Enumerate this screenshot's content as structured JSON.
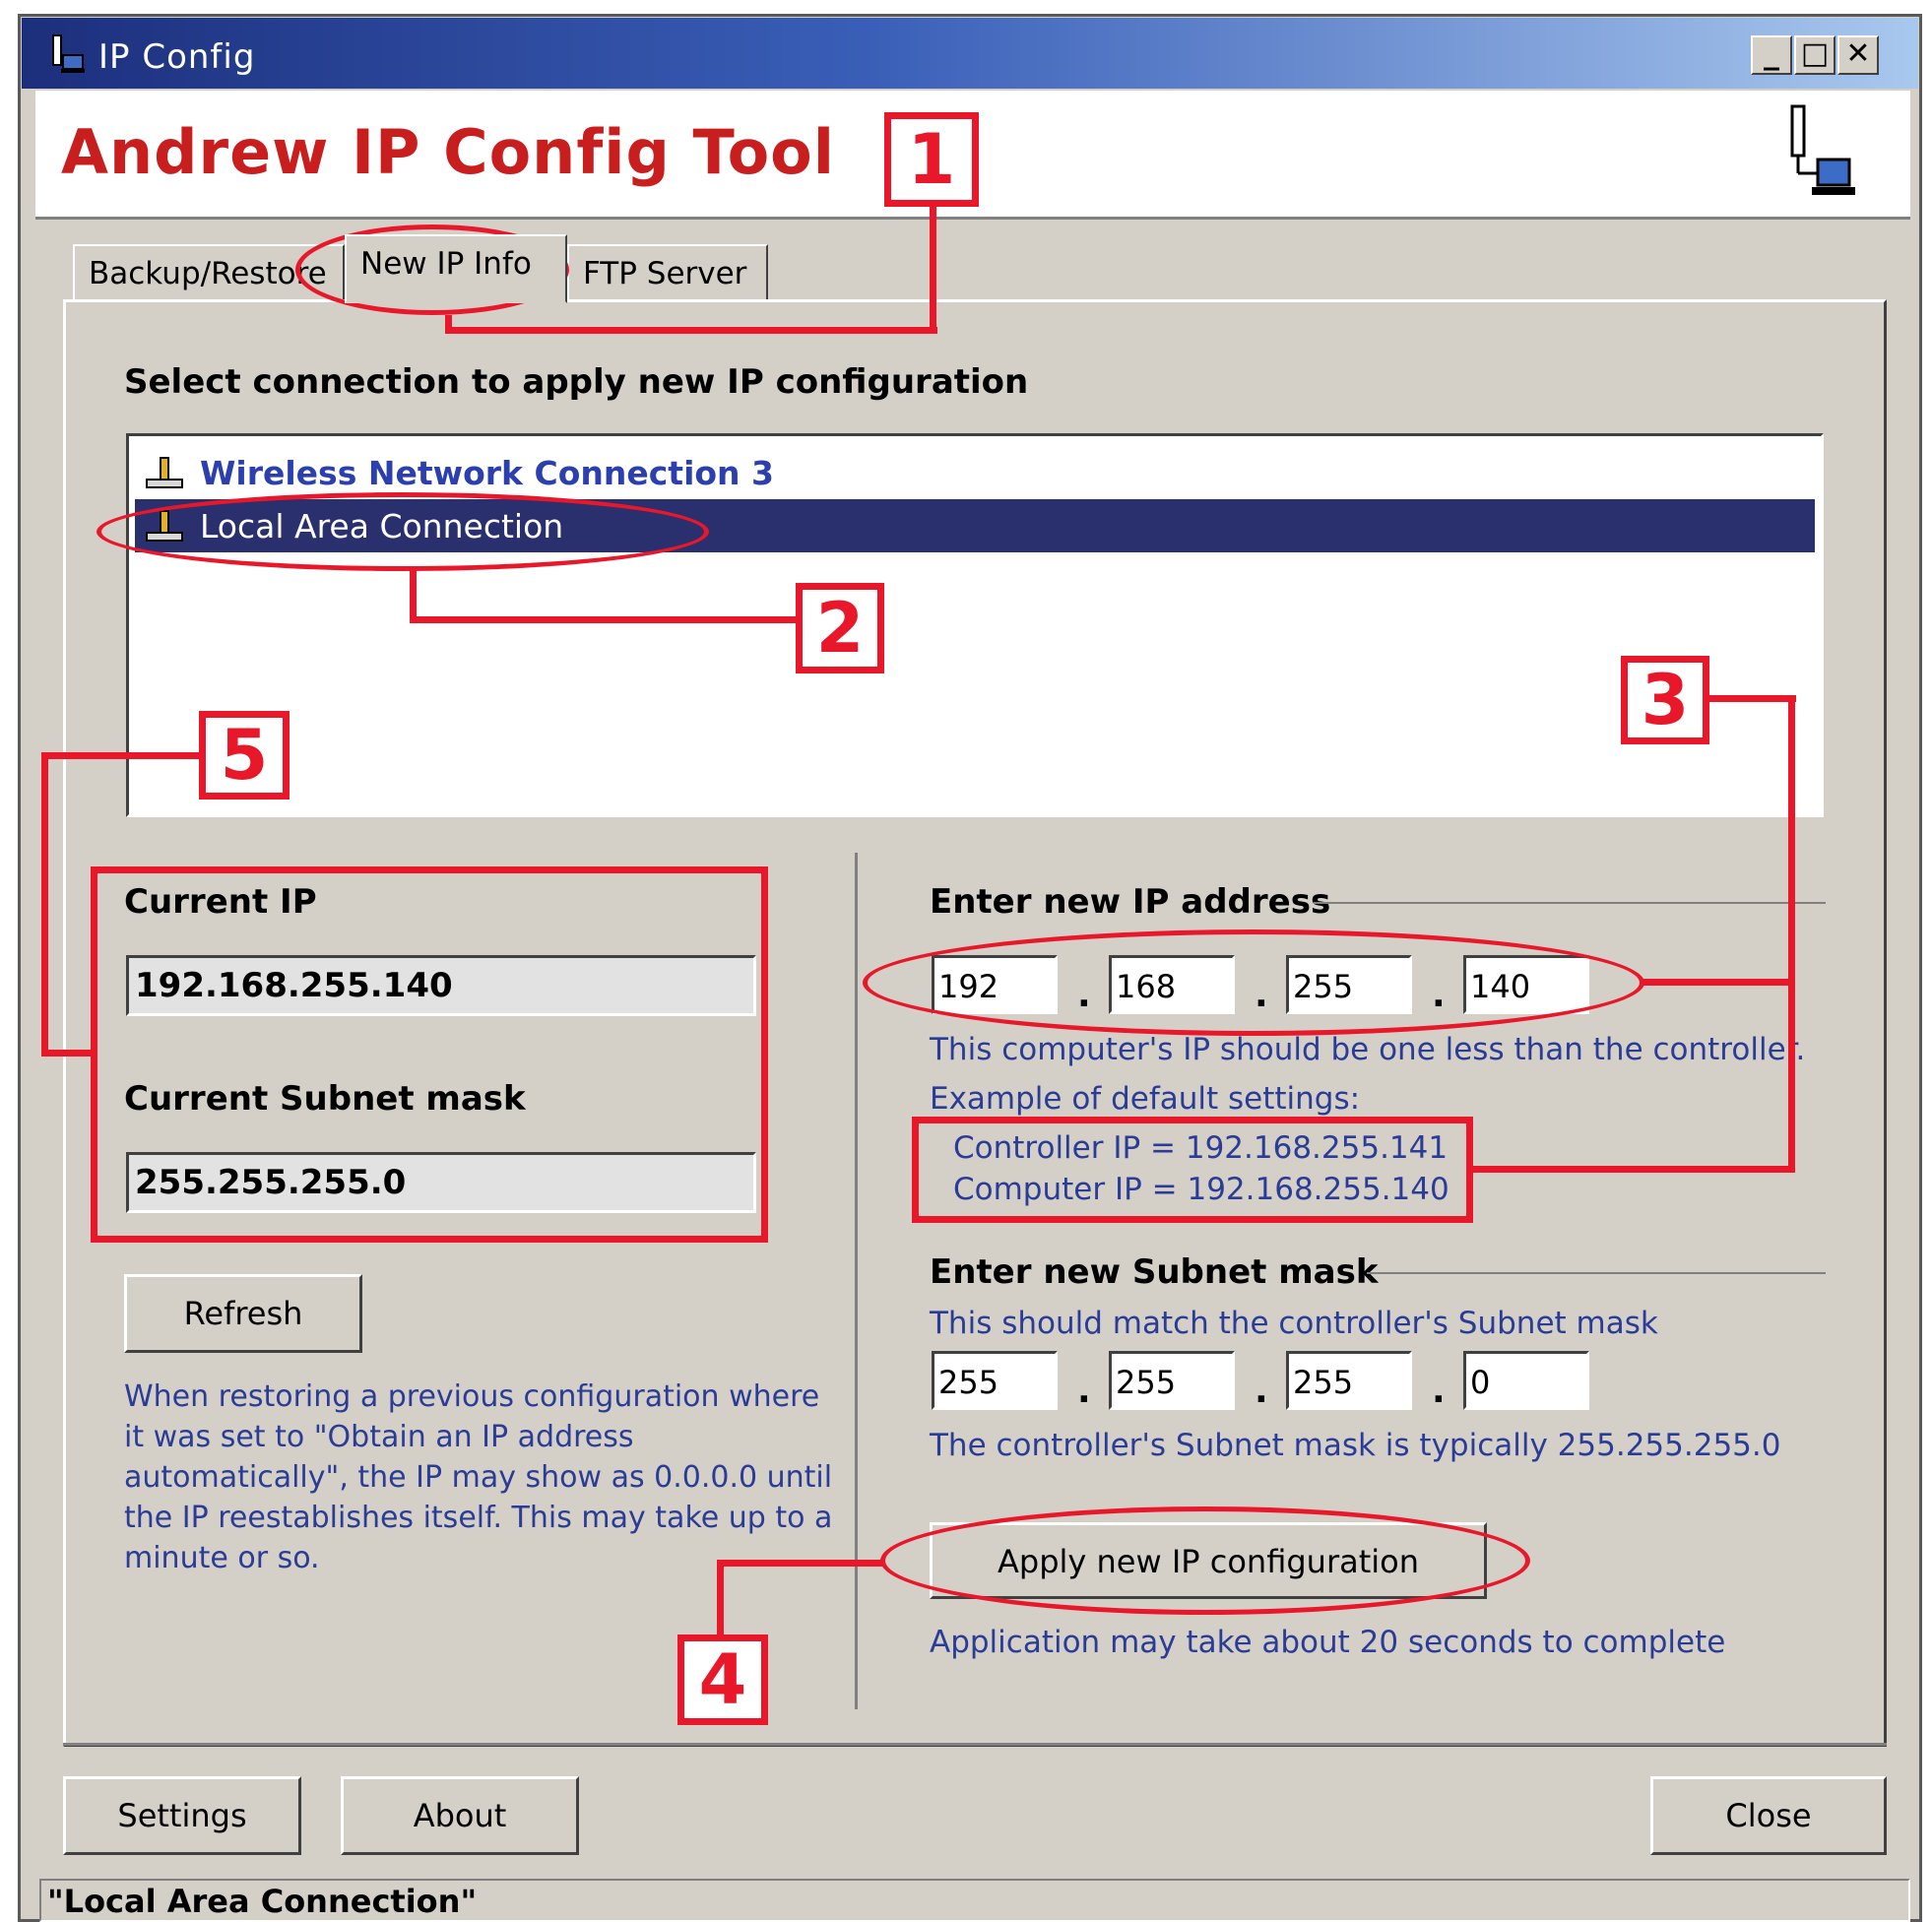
{
  "window": {
    "title": "IP Config",
    "controls": {
      "minimize": "_",
      "maximize": "□",
      "close": "✕"
    }
  },
  "header": {
    "app_title": "Andrew IP Config Tool",
    "logo_icon": "network-computer-icon"
  },
  "tabs": [
    {
      "label": "Backup/Restore",
      "active": false
    },
    {
      "label": "New IP Info",
      "active": true
    },
    {
      "label": "FTP Server",
      "active": false
    }
  ],
  "connections": {
    "heading": "Select connection to apply new IP configuration",
    "items": [
      {
        "label": "Wireless Network Connection 3",
        "selected": false,
        "icon": "network-connection-icon"
      },
      {
        "label": "Local Area Connection",
        "selected": true,
        "icon": "network-connection-icon"
      }
    ]
  },
  "current": {
    "ip_label": "Current IP",
    "ip_value": "192.168.255.140",
    "subnet_label": "Current Subnet mask",
    "subnet_value": "255.255.255.0",
    "refresh_label": "Refresh",
    "restore_note": "When restoring a previous configuration where it was set to \"Obtain an IP address automatically\", the IP may show as 0.0.0.0 until the IP reestablishes itself.  This may take up to a minute or so."
  },
  "new_ip": {
    "heading": "Enter new IP address",
    "octets": [
      "192",
      "168",
      "255",
      "140"
    ],
    "hint": "This computer's IP should be one less than the controller.",
    "example_heading": "Example of default settings:",
    "example_controller": "Controller IP = 192.168.255.141",
    "example_computer": "Computer IP = 192.168.255.140"
  },
  "new_subnet": {
    "heading": "Enter new Subnet mask",
    "hint": "This should match the controller's Subnet mask",
    "octets": [
      "255",
      "255",
      "255",
      "0"
    ],
    "note": "The controller's Subnet mask is typically 255.255.255.0"
  },
  "apply": {
    "button_label": "Apply new IP configuration",
    "note": "Application may take about 20 seconds to complete"
  },
  "footer_buttons": {
    "settings": "Settings",
    "about": "About",
    "close": "Close"
  },
  "status_bar": "\"Local Area Connection\"",
  "annotations": [
    "1",
    "2",
    "3",
    "4",
    "5"
  ],
  "annotation_color": "#e8182a",
  "accent_color": "#2a2f6e"
}
